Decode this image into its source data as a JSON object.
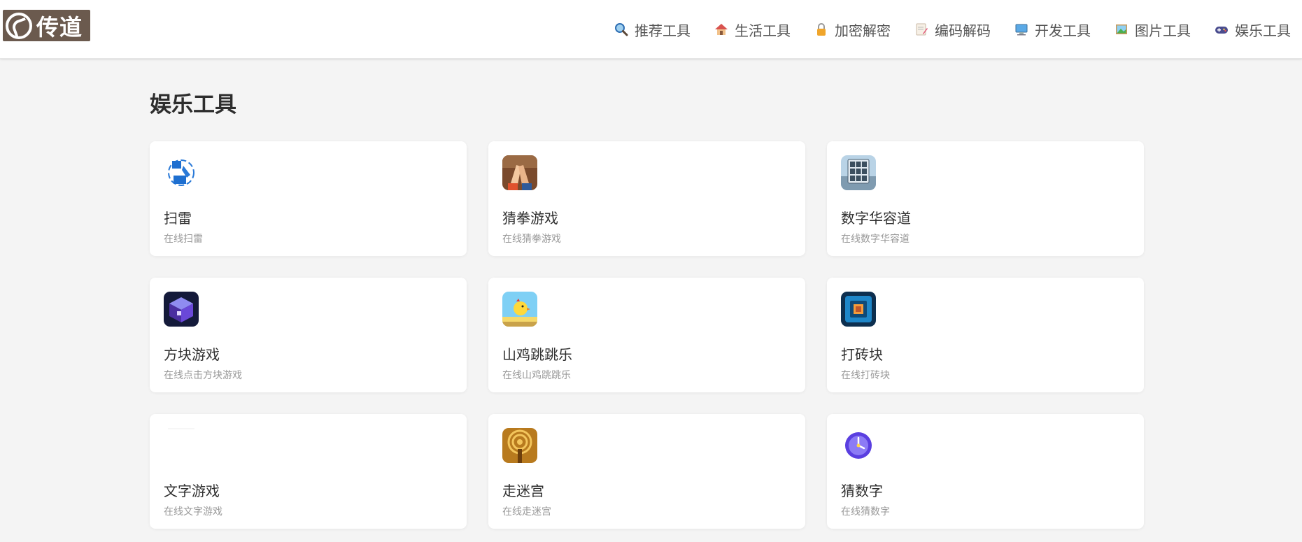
{
  "brand": {
    "logo_text": "传道"
  },
  "nav": [
    {
      "label": "推荐工具",
      "icon": "magnifier-icon"
    },
    {
      "label": "生活工具",
      "icon": "house-icon"
    },
    {
      "label": "加密解密",
      "icon": "lock-icon"
    },
    {
      "label": "编码解码",
      "icon": "memo-icon"
    },
    {
      "label": "开发工具",
      "icon": "computer-icon"
    },
    {
      "label": "图片工具",
      "icon": "picture-icon"
    },
    {
      "label": "娱乐工具",
      "icon": "gamepad-icon"
    }
  ],
  "page": {
    "title": "娱乐工具"
  },
  "tools": [
    {
      "name": "扫雷",
      "desc": "在线扫雷",
      "icon": "minesweeper-icon"
    },
    {
      "name": "猜拳游戏",
      "desc": "在线猜拳游戏",
      "icon": "clapping-hands-icon"
    },
    {
      "name": "数字华容道",
      "desc": "在线数字华容道",
      "icon": "number-puzzle-icon"
    },
    {
      "name": "方块游戏",
      "desc": "在线点击方块游戏",
      "icon": "cube-icon"
    },
    {
      "name": "山鸡跳跳乐",
      "desc": "在线山鸡跳跳乐",
      "icon": "chick-icon"
    },
    {
      "name": "打砖块",
      "desc": "在线打砖块",
      "icon": "brick-breaker-icon"
    },
    {
      "name": "文字游戏",
      "desc": "在线文字游戏",
      "icon": "text-game-icon"
    },
    {
      "name": "走迷宫",
      "desc": "在线走迷宫",
      "icon": "maze-icon"
    },
    {
      "name": "猜数字",
      "desc": "在线猜数字",
      "icon": "compass-clock-icon"
    }
  ]
}
